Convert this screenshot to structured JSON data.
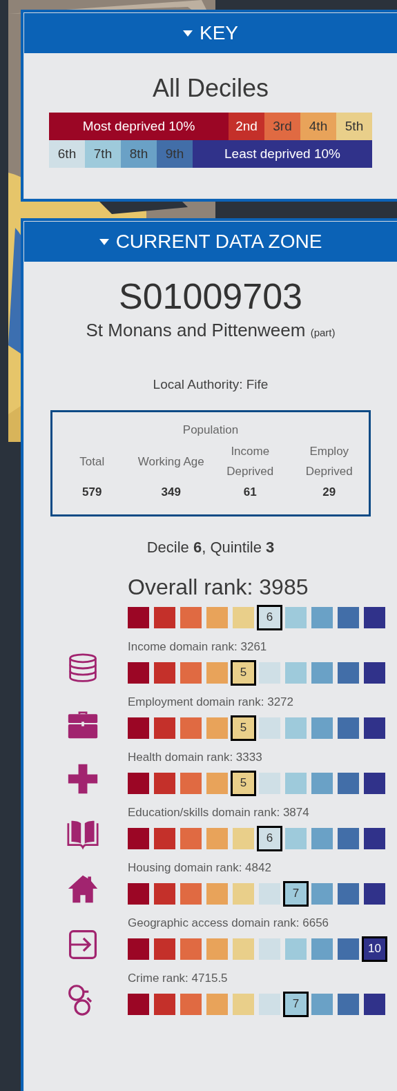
{
  "key": {
    "title": "KEY",
    "heading": "All Deciles",
    "deciles": [
      {
        "label": "Most deprived 10%",
        "color": "#9b0625"
      },
      {
        "label": "2nd",
        "color": "#c4302a"
      },
      {
        "label": "3rd",
        "color": "#e06a42"
      },
      {
        "label": "4th",
        "color": "#e8a35a"
      },
      {
        "label": "5th",
        "color": "#e9cf8a"
      },
      {
        "label": "6th",
        "color": "#cfdfe6"
      },
      {
        "label": "7th",
        "color": "#9ecadb"
      },
      {
        "label": "8th",
        "color": "#6aa1c6"
      },
      {
        "label": "9th",
        "color": "#426ea8"
      },
      {
        "label": "Least deprived 10%",
        "color": "#30328a"
      }
    ]
  },
  "zone": {
    "title": "CURRENT DATA ZONE",
    "code": "S01009703",
    "name": "St Monans and Pittenweem",
    "name_note": "(part)",
    "local_authority": "Local Authority: Fife",
    "population": {
      "title": "Population",
      "columns": [
        {
          "label": "Total",
          "value": "579"
        },
        {
          "label": "Working Age",
          "value": "349"
        },
        {
          "label": "Income Deprived",
          "value": "61"
        },
        {
          "label": "Employ Deprived",
          "value": "29"
        }
      ]
    },
    "summary": "Decile **6**, Quintile **3**",
    "ranks": [
      {
        "kind": "overall",
        "label": "Overall rank: 3985",
        "squares": [
          {
            "selected": false
          },
          {
            "selected": false
          },
          {
            "selected": false
          },
          {
            "selected": false
          },
          {
            "selected": false
          },
          {
            "selected": true,
            "label": "6"
          },
          {
            "selected": false
          },
          {
            "selected": false
          },
          {
            "selected": false
          },
          {
            "selected": false
          }
        ]
      },
      {
        "kind": "income",
        "label": "Income domain rank: 3261",
        "squares": [
          {
            "selected": false
          },
          {
            "selected": false
          },
          {
            "selected": false
          },
          {
            "selected": false
          },
          {
            "selected": true,
            "label": "5"
          },
          {
            "selected": false
          },
          {
            "selected": false
          },
          {
            "selected": false
          },
          {
            "selected": false
          },
          {
            "selected": false
          }
        ]
      },
      {
        "kind": "employment",
        "label": "Employment domain rank: 3272",
        "squares": [
          {
            "selected": false
          },
          {
            "selected": false
          },
          {
            "selected": false
          },
          {
            "selected": false
          },
          {
            "selected": true,
            "label": "5"
          },
          {
            "selected": false
          },
          {
            "selected": false
          },
          {
            "selected": false
          },
          {
            "selected": false
          },
          {
            "selected": false
          }
        ]
      },
      {
        "kind": "health",
        "label": "Health domain rank: 3333",
        "squares": [
          {
            "selected": false
          },
          {
            "selected": false
          },
          {
            "selected": false
          },
          {
            "selected": false
          },
          {
            "selected": true,
            "label": "5"
          },
          {
            "selected": false
          },
          {
            "selected": false
          },
          {
            "selected": false
          },
          {
            "selected": false
          },
          {
            "selected": false
          }
        ]
      },
      {
        "kind": "education",
        "label": "Education/skills domain rank: 3874",
        "squares": [
          {
            "selected": false
          },
          {
            "selected": false
          },
          {
            "selected": false
          },
          {
            "selected": false
          },
          {
            "selected": false
          },
          {
            "selected": true,
            "label": "6"
          },
          {
            "selected": false
          },
          {
            "selected": false
          },
          {
            "selected": false
          },
          {
            "selected": false
          }
        ]
      },
      {
        "kind": "housing",
        "label": "Housing domain rank: 4842",
        "squares": [
          {
            "selected": false
          },
          {
            "selected": false
          },
          {
            "selected": false
          },
          {
            "selected": false
          },
          {
            "selected": false
          },
          {
            "selected": false
          },
          {
            "selected": true,
            "label": "7"
          },
          {
            "selected": false
          },
          {
            "selected": false
          },
          {
            "selected": false
          }
        ]
      },
      {
        "kind": "access",
        "label": "Geographic access domain rank: 6656",
        "squares": [
          {
            "selected": false
          },
          {
            "selected": false
          },
          {
            "selected": false
          },
          {
            "selected": false
          },
          {
            "selected": false
          },
          {
            "selected": false
          },
          {
            "selected": false
          },
          {
            "selected": false
          },
          {
            "selected": false
          },
          {
            "selected": true,
            "label": "10"
          }
        ]
      },
      {
        "kind": "crime",
        "label": "Crime rank: 4715.5",
        "squares": [
          {
            "selected": false
          },
          {
            "selected": false
          },
          {
            "selected": false
          },
          {
            "selected": false
          },
          {
            "selected": false
          },
          {
            "selected": false
          },
          {
            "selected": true,
            "label": "7"
          },
          {
            "selected": false
          },
          {
            "selected": false
          },
          {
            "selected": false
          }
        ]
      }
    ]
  }
}
